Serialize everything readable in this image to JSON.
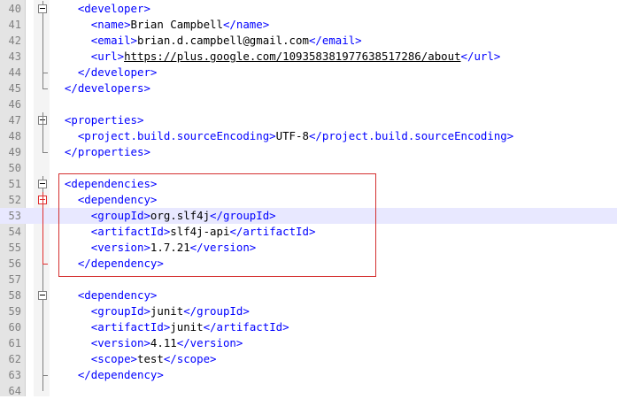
{
  "editor": {
    "lines": [
      {
        "num": "40",
        "indent": "  ",
        "parts": [
          [
            "tag",
            "<developer>"
          ]
        ]
      },
      {
        "num": "41",
        "indent": "    ",
        "parts": [
          [
            "tag",
            "<name>"
          ],
          [
            "txt",
            "Brian Campbell"
          ],
          [
            "tag",
            "</name>"
          ]
        ]
      },
      {
        "num": "42",
        "indent": "    ",
        "parts": [
          [
            "tag",
            "<email>"
          ],
          [
            "txt",
            "brian.d.campbell@gmail.com"
          ],
          [
            "tag",
            "</email>"
          ]
        ]
      },
      {
        "num": "43",
        "indent": "    ",
        "parts": [
          [
            "tag",
            "<url>"
          ],
          [
            "url",
            "https://plus.google.com/109358381977638517286/about"
          ],
          [
            "tag",
            "</url>"
          ]
        ]
      },
      {
        "num": "44",
        "indent": "  ",
        "parts": [
          [
            "tag",
            "</developer>"
          ]
        ]
      },
      {
        "num": "45",
        "indent": "",
        "parts": [
          [
            "tag",
            "</developers>"
          ]
        ]
      },
      {
        "num": "46",
        "indent": "",
        "parts": []
      },
      {
        "num": "47",
        "indent": "",
        "parts": [
          [
            "tag",
            "<properties>"
          ]
        ]
      },
      {
        "num": "48",
        "indent": "  ",
        "parts": [
          [
            "tag",
            "<project.build.sourceEncoding>"
          ],
          [
            "txt",
            "UTF-8"
          ],
          [
            "tag",
            "</project.build.sourceEncoding>"
          ]
        ]
      },
      {
        "num": "49",
        "indent": "",
        "parts": [
          [
            "tag",
            "</properties>"
          ]
        ]
      },
      {
        "num": "50",
        "indent": "",
        "parts": []
      },
      {
        "num": "51",
        "indent": "",
        "parts": [
          [
            "tag",
            "<dependencies>"
          ]
        ]
      },
      {
        "num": "52",
        "indent": "  ",
        "parts": [
          [
            "tag",
            "<dependency>"
          ]
        ]
      },
      {
        "num": "53",
        "indent": "    ",
        "parts": [
          [
            "tag",
            "<groupId>"
          ],
          [
            "txt",
            "org.slf4j"
          ],
          [
            "tag",
            "</groupId>"
          ]
        ]
      },
      {
        "num": "54",
        "indent": "    ",
        "parts": [
          [
            "tag",
            "<artifactId>"
          ],
          [
            "txt",
            "slf4j-api"
          ],
          [
            "tag",
            "</artifactId>"
          ]
        ]
      },
      {
        "num": "55",
        "indent": "    ",
        "parts": [
          [
            "tag",
            "<version>"
          ],
          [
            "txt",
            "1.7.21"
          ],
          [
            "tag",
            "</version>"
          ]
        ]
      },
      {
        "num": "56",
        "indent": "  ",
        "parts": [
          [
            "tag",
            "</dependency>"
          ]
        ]
      },
      {
        "num": "57",
        "indent": "",
        "parts": []
      },
      {
        "num": "58",
        "indent": "  ",
        "parts": [
          [
            "tag",
            "<dependency>"
          ]
        ]
      },
      {
        "num": "59",
        "indent": "    ",
        "parts": [
          [
            "tag",
            "<groupId>"
          ],
          [
            "txt",
            "junit"
          ],
          [
            "tag",
            "</groupId>"
          ]
        ]
      },
      {
        "num": "60",
        "indent": "    ",
        "parts": [
          [
            "tag",
            "<artifactId>"
          ],
          [
            "txt",
            "junit"
          ],
          [
            "tag",
            "</artifactId>"
          ]
        ]
      },
      {
        "num": "61",
        "indent": "    ",
        "parts": [
          [
            "tag",
            "<version>"
          ],
          [
            "txt",
            "4.11"
          ],
          [
            "tag",
            "</version>"
          ]
        ]
      },
      {
        "num": "62",
        "indent": "    ",
        "parts": [
          [
            "tag",
            "<scope>"
          ],
          [
            "txt",
            "test"
          ],
          [
            "tag",
            "</scope>"
          ]
        ]
      },
      {
        "num": "63",
        "indent": "  ",
        "parts": [
          [
            "tag",
            "</dependency>"
          ]
        ]
      },
      {
        "num": "64",
        "indent": "",
        "parts": []
      }
    ],
    "current_line": "53",
    "colors": {
      "tag": "#0000ff",
      "text": "#000000",
      "highlight_box": "#d43030",
      "current_line_bg": "#e8e8ff"
    }
  }
}
